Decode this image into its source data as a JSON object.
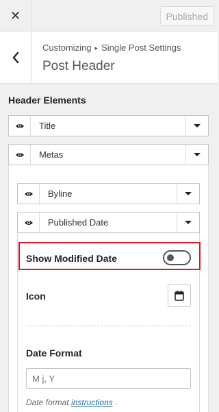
{
  "topbar": {
    "close_label": "✕",
    "publish_label": "Published"
  },
  "section": {
    "breadcrumb_root": "Customizing",
    "breadcrumb_sep": "▸",
    "breadcrumb_page": "Single Post Settings",
    "title": "Post Header"
  },
  "header_elements": {
    "label": "Header Elements",
    "items": [
      {
        "label": "Title"
      },
      {
        "label": "Metas"
      }
    ]
  },
  "metas": {
    "items": [
      {
        "label": "Byline"
      },
      {
        "label": "Published Date"
      }
    ]
  },
  "published_date_options": {
    "show_modified_label": "Show Modified Date",
    "show_modified_on": false,
    "icon_label": "Icon",
    "date_format_label": "Date Format",
    "date_format_placeholder": "M j, Y",
    "help_prefix": "Date format",
    "help_link": "instructions",
    "help_suffix": "."
  },
  "colors": {
    "highlight": "#e0151f",
    "link": "#2271b1"
  }
}
